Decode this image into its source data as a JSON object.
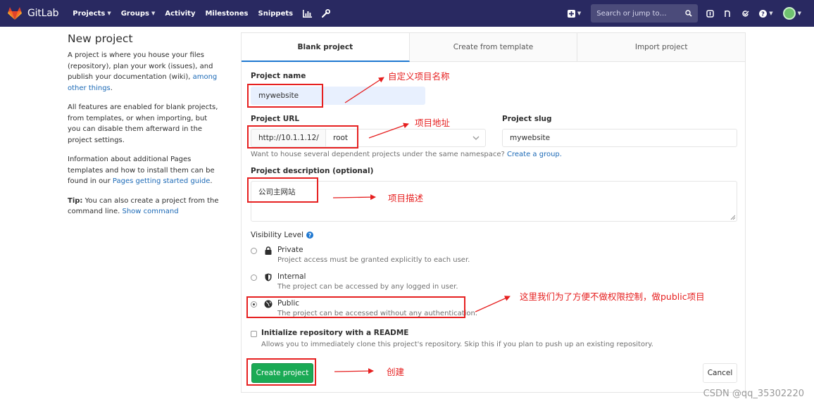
{
  "nav": {
    "brand": "GitLab",
    "links": [
      {
        "label": "Projects",
        "caret": true
      },
      {
        "label": "Groups",
        "caret": true
      },
      {
        "label": "Activity",
        "caret": false
      },
      {
        "label": "Milestones",
        "caret": false
      },
      {
        "label": "Snippets",
        "caret": false
      }
    ],
    "search_placeholder": "Search or jump to…",
    "colors": {
      "bar": "#292961",
      "logo": "#fc6d26"
    }
  },
  "sidebar": {
    "title": "New project",
    "p1_text": "A project is where you house your files (repository), plan your work (issues), and publish your documentation (wiki), ",
    "p1_link": "among other things",
    "p1_end": ".",
    "p2": "All features are enabled for blank projects, from templates, or when importing, but you can disable them afterward in the project settings.",
    "p3_text": "Information about additional Pages templates and how to install them can be found in our ",
    "p3_link": "Pages getting started guide",
    "p3_end": ".",
    "tip_label": "Tip:",
    "tip_text": " You can also create a project from the command line. ",
    "tip_link": "Show command"
  },
  "tabs": [
    {
      "label": "Blank project",
      "active": true
    },
    {
      "label": "Create from template",
      "active": false
    },
    {
      "label": "Import project",
      "active": false
    }
  ],
  "form": {
    "project_name_label": "Project name",
    "project_name_value": "mywebsite",
    "project_url_label": "Project URL",
    "url_prefix": "http://10.1.1.12/",
    "namespace_value": "root",
    "project_slug_label": "Project slug",
    "project_slug_value": "mywebsite",
    "namespace_help": "Want to house several dependent projects under the same namespace? ",
    "namespace_help_link": "Create a group.",
    "description_label": "Project description (optional)",
    "description_value": "公司主网站",
    "visibility_label": "Visibility Level",
    "visibility_options": [
      {
        "title": "Private",
        "desc": "Project access must be granted explicitly to each user.",
        "icon": "lock-icon",
        "selected": false
      },
      {
        "title": "Internal",
        "desc": "The project can be accessed by any logged in user.",
        "icon": "shield-icon",
        "selected": false
      },
      {
        "title": "Public",
        "desc": "The project can be accessed without any authentication.",
        "icon": "globe-icon",
        "selected": true
      }
    ],
    "readme_label": "Initialize repository with a README",
    "readme_desc": "Allows you to immediately clone this project's repository. Skip this if you plan to push up an existing repository.",
    "readme_checked": false,
    "create_button": "Create project",
    "cancel_button": "Cancel"
  },
  "annotations": {
    "name": "自定义项目名称",
    "url": "项目地址",
    "description": "项目描述",
    "public": "这里我们为了方便不做权限控制，做public项目",
    "create": "创建",
    "color": "#e62020"
  },
  "watermark": "CSDN @qq_35302220"
}
